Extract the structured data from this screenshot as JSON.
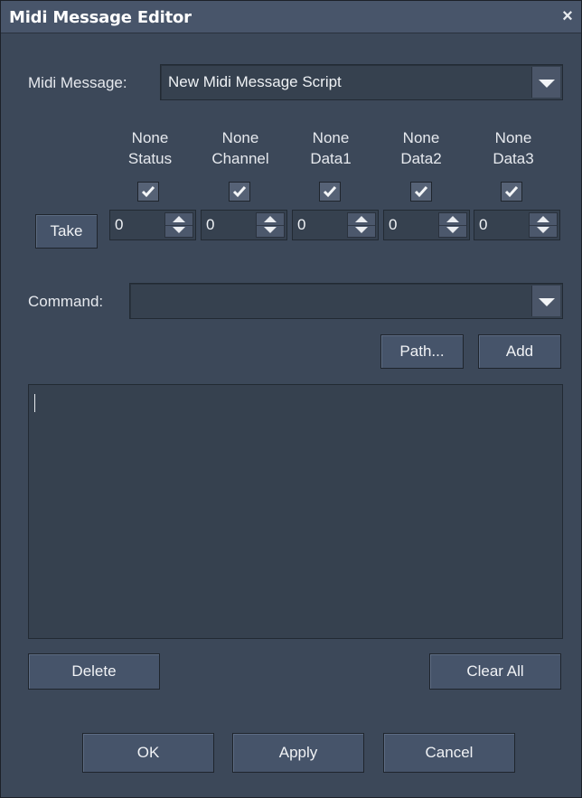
{
  "window": {
    "title": "Midi Message Editor",
    "close_glyph": "×"
  },
  "midi_message": {
    "label": "Midi Message:",
    "value": "New Midi Message Script"
  },
  "columns": [
    {
      "top": "None",
      "bottom": "Status",
      "checked": true,
      "value": "0"
    },
    {
      "top": "None",
      "bottom": "Channel",
      "checked": true,
      "value": "0"
    },
    {
      "top": "None",
      "bottom": "Data1",
      "checked": true,
      "value": "0"
    },
    {
      "top": "None",
      "bottom": "Data2",
      "checked": true,
      "value": "0"
    },
    {
      "top": "None",
      "bottom": "Data3",
      "checked": true,
      "value": "0"
    }
  ],
  "take_button": "Take",
  "command": {
    "label": "Command:",
    "value": ""
  },
  "path_button": "Path...",
  "add_button": "Add",
  "script_text": "",
  "delete_button": "Delete",
  "clear_all_button": "Clear All",
  "ok_button": "OK",
  "apply_button": "Apply",
  "cancel_button": "Cancel",
  "icons": {
    "close": "close-icon",
    "dropdown": "chevron-down-icon",
    "check": "checkmark-icon",
    "spinner": "spinner-arrows-icon"
  },
  "colors": {
    "window_bg": "#3c4859",
    "titlebar": "#48556a",
    "field_bg": "#36414f",
    "button_bg": "#46546a",
    "text": "#e6e9ee"
  }
}
